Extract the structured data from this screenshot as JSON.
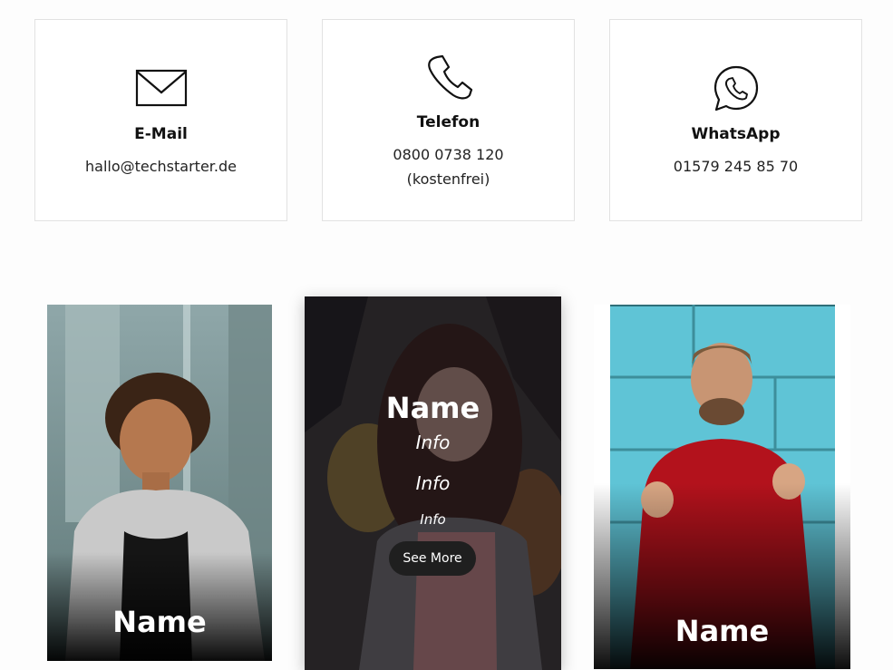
{
  "contacts": [
    {
      "icon": "envelope-icon",
      "title": "E-Mail",
      "value": "hallo@techstarter.de"
    },
    {
      "icon": "phone-icon",
      "title": "Telefon",
      "value": "0800 0738 120",
      "note": "(kostenfrei)"
    },
    {
      "icon": "whatsapp-icon",
      "title": "WhatsApp",
      "value": "01579 245 85 70"
    }
  ],
  "team": [
    {
      "name": "Name"
    },
    {
      "name": "Name",
      "info": [
        "Info",
        "Info",
        "Info"
      ],
      "button": "See More"
    },
    {
      "name": "Name"
    }
  ],
  "colors": {
    "card_border": "#e2e2e2",
    "button_bg": "#1f1f1f",
    "wall_blue": "#5fc4d6",
    "sweater_red": "#b3121c"
  }
}
